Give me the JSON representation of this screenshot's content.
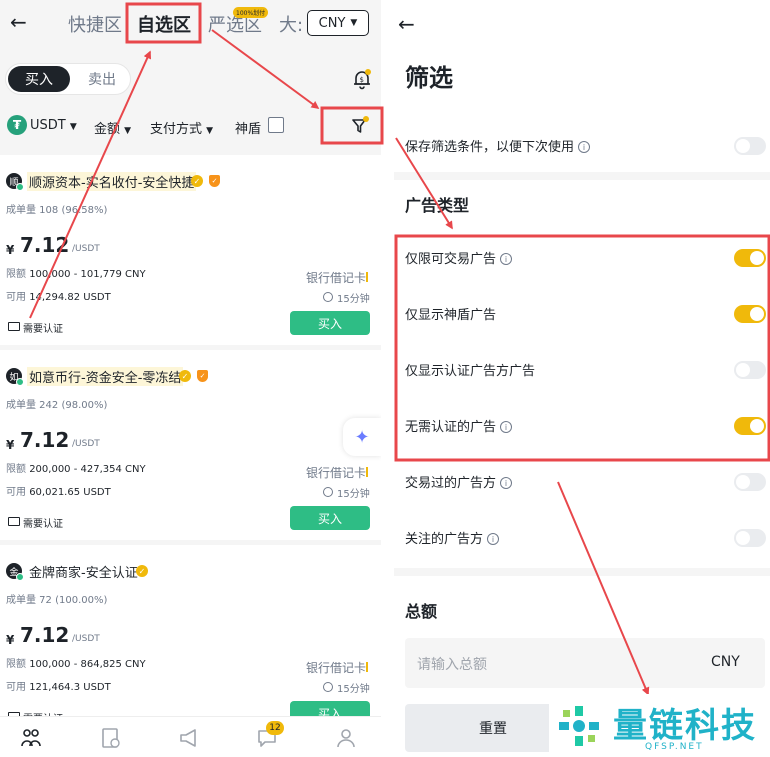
{
  "left": {
    "header": {
      "tabs": [
        "快捷区",
        "自选区",
        "严选区",
        "大:"
      ],
      "hot_badge": "100%划付",
      "currency": "CNY"
    },
    "side_tabs": {
      "buy": "买入",
      "sell": "卖出"
    },
    "filters": {
      "asset": "USDT",
      "amount": "金额",
      "payment": "支付方式",
      "shield": "神盾"
    },
    "ads": [
      {
        "avatar": "顺",
        "name": "顺源资本-实名收付-安全快捷",
        "orders": "成单量 108 (96.58%)",
        "currency_symbol": "¥",
        "price": "7.12",
        "price_unit": "/USDT",
        "limit_label": "限额",
        "limit": "100,000 - 101,779 CNY",
        "available_label": "可用",
        "available": "14,294.82 USDT",
        "payment": "银行借记卡",
        "time": "15分钟",
        "kyc": "需要认证",
        "buy": "买入"
      },
      {
        "avatar": "如",
        "name": "如意币行-资金安全-零冻结",
        "orders": "成单量 242 (98.00%)",
        "currency_symbol": "¥",
        "price": "7.12",
        "price_unit": "/USDT",
        "limit_label": "限额",
        "limit": "200,000 - 427,354 CNY",
        "available_label": "可用",
        "available": "60,021.65 USDT",
        "payment": "银行借记卡",
        "time": "15分钟",
        "kyc": "需要认证",
        "buy": "买入"
      },
      {
        "avatar": "金",
        "name": "金牌商家-安全认证",
        "orders": "成单量 72 (100.00%)",
        "currency_symbol": "¥",
        "price": "7.12",
        "price_unit": "/USDT",
        "limit_label": "限额",
        "limit": "100,000 - 864,825 CNY",
        "available_label": "可用",
        "available": "121,464.3 USDT",
        "payment": "银行借记卡",
        "time": "15分钟",
        "kyc": "需要认证",
        "buy": "买入"
      }
    ],
    "nav_badge": "12"
  },
  "right": {
    "title": "筛选",
    "save_label": "保存筛选条件，以便下次使用",
    "ad_type_title": "广告类型",
    "options": [
      {
        "label": "仅限可交易广告",
        "info": true,
        "on": true
      },
      {
        "label": "仅显示神盾广告",
        "info": false,
        "on": true
      },
      {
        "label": "仅显示认证广告方广告",
        "info": false,
        "on": false
      },
      {
        "label": "无需认证的广告",
        "info": true,
        "on": true
      },
      {
        "label": "交易过的广告方",
        "info": true,
        "on": false
      },
      {
        "label": "关注的广告方",
        "info": true,
        "on": false
      }
    ],
    "save_on": false,
    "total_title": "总额",
    "amount_placeholder": "请输入总额",
    "amount_currency": "CNY",
    "reset": "重置"
  },
  "watermark": {
    "name": "量链科技",
    "domain": "QFSP.NET"
  },
  "colors": {
    "accent": "#f0b90b",
    "buy_green": "#2ebd85",
    "annotation_red": "#e8474b"
  }
}
